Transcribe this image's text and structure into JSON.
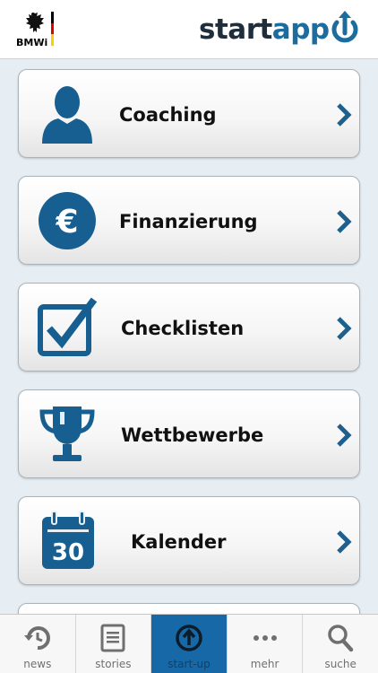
{
  "header": {
    "ministry_label": "BMWi",
    "brand_part1": "start",
    "brand_part2": "app"
  },
  "colors": {
    "brand_blue": "#1c6c9e",
    "icon_blue": "#175f91",
    "active_tab": "#1668a7",
    "background": "#e6eef4"
  },
  "menu": {
    "items": [
      {
        "label": "Coaching",
        "icon": "person-icon"
      },
      {
        "label": "Finanzierung",
        "icon": "euro-icon"
      },
      {
        "label": "Checklisten",
        "icon": "checkbox-icon"
      },
      {
        "label": "Wettbewerbe",
        "icon": "trophy-icon"
      },
      {
        "label": "Kalender",
        "icon": "calendar-icon",
        "icon_text": "30"
      }
    ]
  },
  "tabs": [
    {
      "label": "news",
      "icon": "history-icon",
      "active": false
    },
    {
      "label": "stories",
      "icon": "document-icon",
      "active": false
    },
    {
      "label": "start-up",
      "icon": "upload-circle-icon",
      "active": true
    },
    {
      "label": "mehr",
      "icon": "more-dots-icon",
      "active": false
    },
    {
      "label": "suche",
      "icon": "search-icon",
      "active": false
    }
  ]
}
